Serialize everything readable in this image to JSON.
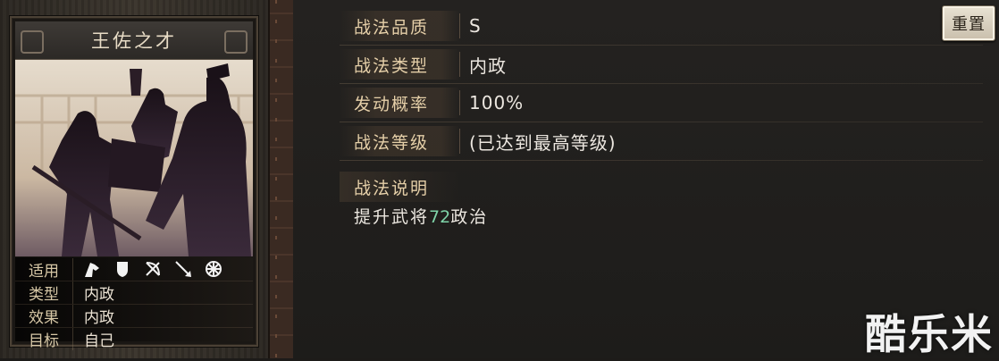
{
  "card": {
    "title": "王佐之才",
    "info": [
      {
        "label": "适用",
        "value": ""
      },
      {
        "label": "类型",
        "value": "内政"
      },
      {
        "label": "效果",
        "value": "内政"
      },
      {
        "label": "目标",
        "value": "自己"
      }
    ],
    "troop_icons": [
      "cavalry-icon",
      "shield-icon",
      "bow-icon",
      "spear-icon",
      "wheel-icon"
    ]
  },
  "details": {
    "quality_label": "战法品质",
    "quality_value": "S",
    "type_label": "战法类型",
    "type_value": "内政",
    "rate_label": "发动概率",
    "rate_value": "100%",
    "level_label": "战法等级",
    "level_value": "(已达到最高等级)",
    "desc_label": "战法说明",
    "desc_prefix": "提升武将",
    "desc_number": "72",
    "desc_suffix": "政治"
  },
  "buttons": {
    "reset_label": "重置"
  },
  "watermark": "酷乐米",
  "colors": {
    "label": "#e5cfa8",
    "value": "#ece7e0",
    "highlight": "#7fd3a8",
    "background": "#1d1b19"
  }
}
